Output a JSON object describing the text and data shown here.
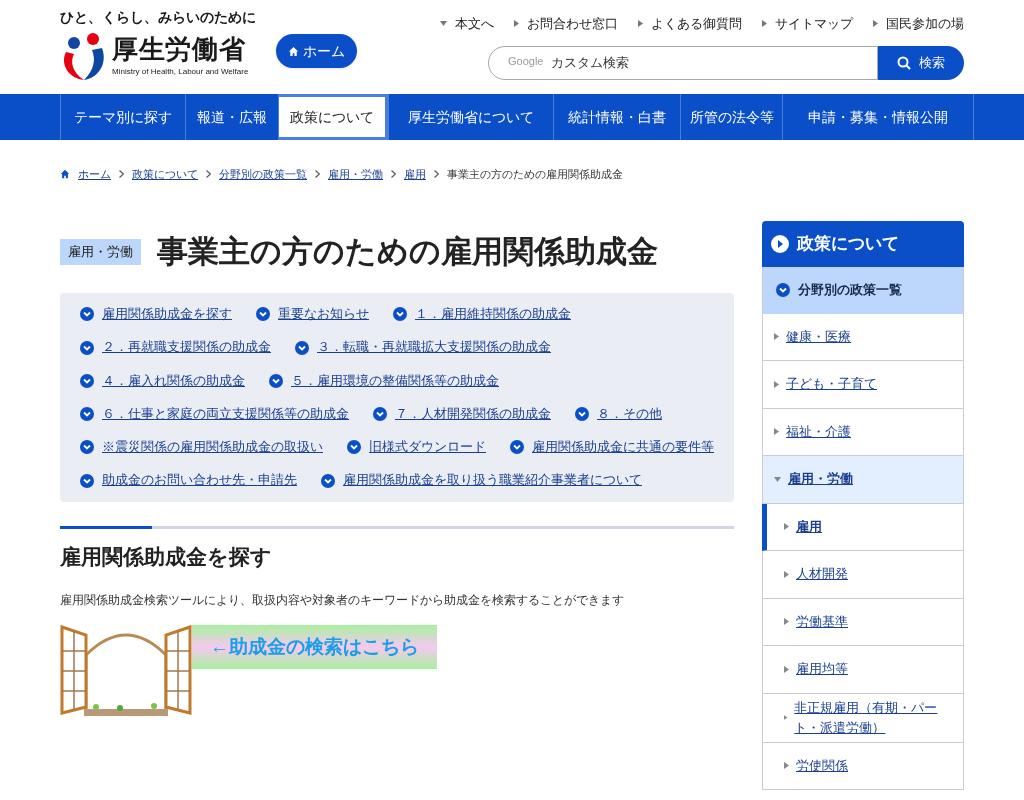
{
  "header": {
    "tagline": "ひと、くらし、みらいのために",
    "ministry_name": "厚生労働省",
    "ministry_name_en": "Ministry of Health, Labour and Welfare",
    "home_button": "ホーム",
    "utility_links": [
      {
        "label": "本文へ",
        "kind": "down"
      },
      {
        "label": "お問合わせ窓口",
        "kind": "right"
      },
      {
        "label": "よくある御質問",
        "kind": "right"
      },
      {
        "label": "サイトマップ",
        "kind": "right"
      },
      {
        "label": "国民参加の場",
        "kind": "right"
      }
    ],
    "search": {
      "brand": "Google",
      "placeholder": "カスタム検索",
      "button": "検索"
    }
  },
  "nav": [
    {
      "label": "テーマ別に探す",
      "selected": false
    },
    {
      "label": "報道・広報",
      "selected": false
    },
    {
      "label": "政策について",
      "selected": true
    },
    {
      "label": "厚生労働省について",
      "selected": false
    },
    {
      "label": "統計情報・白書",
      "selected": false
    },
    {
      "label": "所管の法令等",
      "selected": false
    },
    {
      "label": "申請・募集・情報公開",
      "selected": false
    }
  ],
  "breadcrumb": [
    {
      "label": "ホーム",
      "link": true
    },
    {
      "label": "政策について",
      "link": true
    },
    {
      "label": "分野別の政策一覧",
      "link": true
    },
    {
      "label": "雇用・労働",
      "link": true
    },
    {
      "label": "雇用",
      "link": true
    },
    {
      "label": "事業主の方のための雇用関係助成金",
      "link": false
    }
  ],
  "page": {
    "category": "雇用・労働",
    "title": "事業主の方のための雇用関係助成金",
    "anchor_links": [
      [
        "雇用関係助成金を探す",
        "重要なお知らせ",
        "１．雇用維持関係の助成金"
      ],
      [
        "２．再就職支援関係の助成金",
        "３．転職・再就職拡大支援関係の助成金"
      ],
      [
        "４．雇入れ関係の助成金",
        "５．雇用環境の整備関係等の助成金"
      ],
      [
        "６．仕事と家庭の両立支援関係等の助成金",
        "７．人材開発関係の助成金",
        "８．その他"
      ],
      [
        "※震災関係の雇用関係助成金の取扱い",
        "旧様式ダウンロード",
        "雇用関係助成金に共通の要件等"
      ],
      [
        "助成金のお問い合わせ先・申請先",
        "雇用関係助成金を取り扱う職業紹介事業者について"
      ]
    ],
    "section_heading": "雇用関係助成金を探す",
    "section_text": "雇用関係助成金検索ツールにより、取扱内容や対象者のキーワードから助成金を検索することができます",
    "search_banner": "←助成金の検索はこちら"
  },
  "sidebar": {
    "title": "政策について",
    "section": {
      "label": "分野別の政策一覧",
      "expanded": true,
      "children": [
        {
          "label": "健康・医療",
          "expanded": false,
          "selected": false
        },
        {
          "label": "子ども・子育て",
          "expanded": false,
          "selected": false
        },
        {
          "label": "福祉・介護",
          "expanded": false,
          "selected": false
        },
        {
          "label": "雇用・労働",
          "expanded": true,
          "selected": false,
          "children": [
            {
              "label": "雇用",
              "expanded": false,
              "selected": true
            },
            {
              "label": "人材開発",
              "expanded": false,
              "selected": false
            },
            {
              "label": "労働基準",
              "expanded": false,
              "selected": false
            },
            {
              "label": "雇用均等",
              "expanded": false,
              "selected": false
            },
            {
              "label": "非正規雇用（有期・パート・派遣労働）",
              "expanded": false,
              "selected": false
            },
            {
              "label": "労使関係",
              "expanded": false,
              "selected": false
            }
          ]
        }
      ]
    }
  }
}
